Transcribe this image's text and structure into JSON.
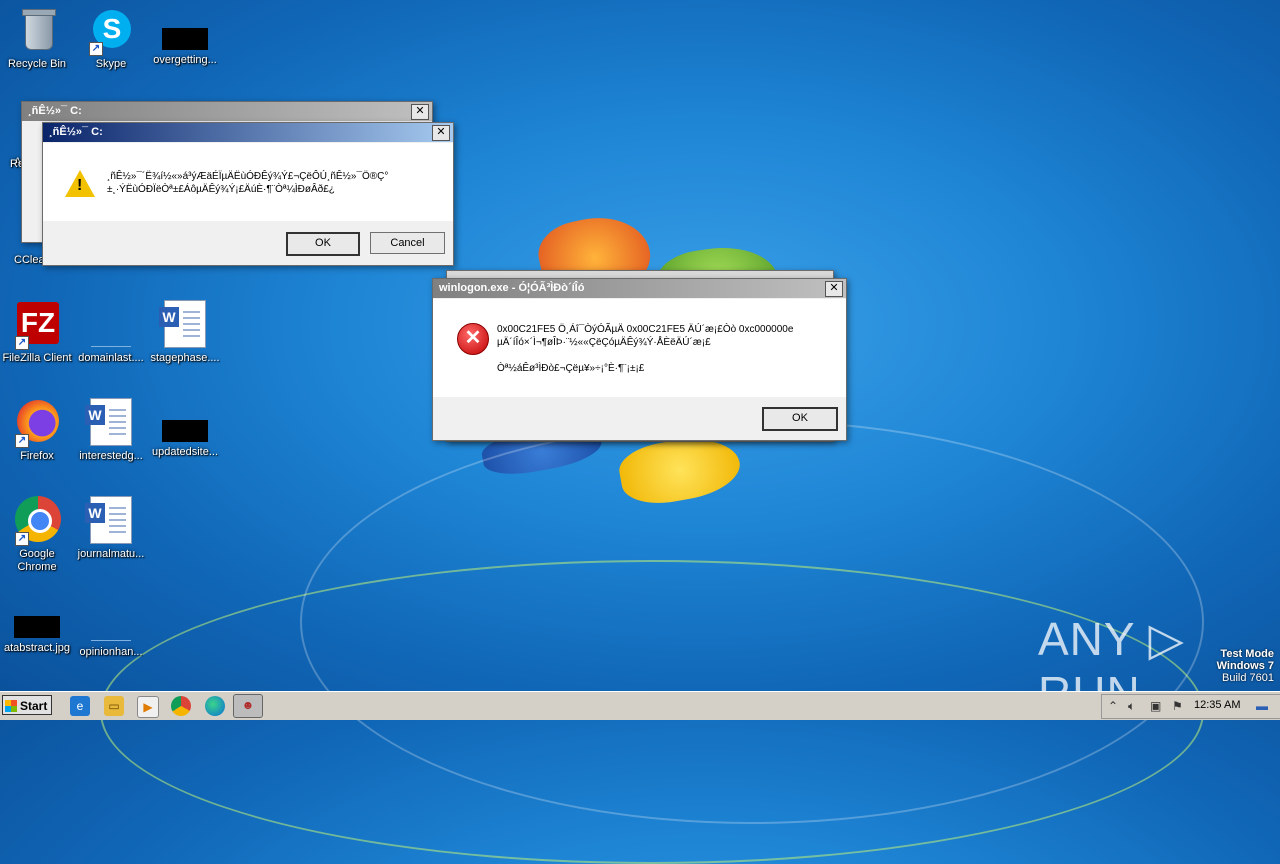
{
  "desktop": {
    "icons": [
      {
        "label": "Recycle Bin"
      },
      {
        "label": "Skype"
      },
      {
        "label": "overgetting..."
      },
      {
        "label": "FileZilla Client"
      },
      {
        "label": "domainlast...."
      },
      {
        "label": "stagephase...."
      },
      {
        "label": "Firefox"
      },
      {
        "label": "interestedg..."
      },
      {
        "label": "updatedsite..."
      },
      {
        "label": "Google Chrome"
      },
      {
        "label": "journalmatu..."
      },
      {
        "label": "atabstract.jpg"
      },
      {
        "label": "opinionhan..."
      },
      {
        "label": "CClea"
      },
      {
        "label": "A"
      },
      {
        "label": "Re"
      }
    ]
  },
  "dialog_back": {
    "title": "¸ñÊ½»¯ C:",
    "close": "✕"
  },
  "dialog_format": {
    "title": "¸ñÊ½»¯ C:",
    "close": "✕",
    "message_line1": "¸ñÊ½»¯´Ë¾í½«»á³ýÆäÉÏµÄËùÓÐÊý¾Ý£¬ÇëÔÚ¸ñÊ½»¯Ö®Ç°",
    "message_line2": "±¸·ÝËùÓÐÏëÒª±£ÁôµÄÊý¾Ý¡£ÄúÈ·¶¨Òª¼ÌÐøÂð£¿",
    "ok_label": "OK",
    "cancel_label": "Cancel"
  },
  "dialog_error": {
    "title": "winlogon.exe - Ó¦ÓÃ³ÌÐò´íÎó",
    "close": "✕",
    "message_line1": "0x00C21FE5 Ö¸Áî¯ÒýÓÃµÄ 0x00C21FE5 ÄÚ´æ¡£Òò 0xc000000e",
    "message_line2": "µÄ´íÎó×´Ì¬¶øÎÞ·¨½««ÇëÇóµÄÊý¾Ý·ÅÈëÄÚ´æ¡£",
    "message_line3": "Òª½áÊø³ÌÐò£¬Çëµ¥»÷¡°È·¶¨¡±¡£",
    "ok_label": "OK"
  },
  "taskbar": {
    "start_label": "Start",
    "clock": "12:35 AM"
  },
  "watermark": {
    "text": "ANY ▷ RUN"
  },
  "test_mode": {
    "line1": "Test Mode",
    "line2": "Windows 7",
    "line3": "Build 7601"
  },
  "colors": {
    "accent_title": "#0a246a",
    "desktop": "#1f86d6"
  }
}
